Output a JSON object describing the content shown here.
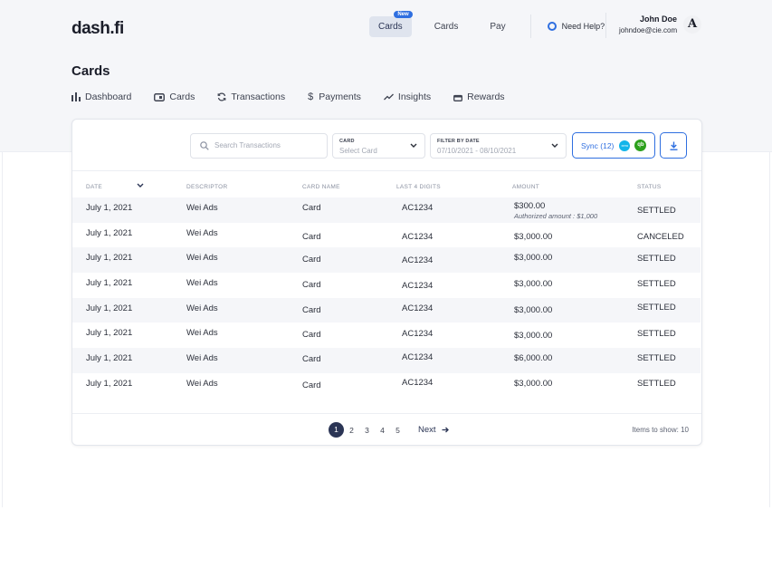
{
  "brand": {
    "logo": "dash.fi"
  },
  "topnav": {
    "items": [
      {
        "label": "Cards",
        "badge": "New",
        "active": true
      },
      {
        "label": "Cards"
      },
      {
        "label": "Pay"
      }
    ],
    "help_label": "Need Help?"
  },
  "user": {
    "name": "John Doe",
    "email": "johndoe@cie.com",
    "avatar_letter": "A"
  },
  "page": {
    "title": "Cards"
  },
  "subnav": [
    {
      "label": "Dashboard",
      "icon": "bar-chart-icon"
    },
    {
      "label": "Cards",
      "icon": "card-icon"
    },
    {
      "label": "Transactions",
      "icon": "refresh-icon"
    },
    {
      "label": "Payments",
      "icon": "dollar-icon"
    },
    {
      "label": "Insights",
      "icon": "trend-icon"
    },
    {
      "label": "Rewards",
      "icon": "gift-icon"
    }
  ],
  "filters": {
    "search_placeholder": "Search Transactions",
    "card_label": "CARD",
    "card_value": "Select Card",
    "date_label": "FILTER BY DATE",
    "date_value": "07/10/2021 - 08/10/2021",
    "sync_label": "Sync (12)",
    "xero_label": "xero",
    "qb_label": "qb"
  },
  "table": {
    "headers": [
      "DATE",
      "DESCRIPTOR",
      "CARD NAME",
      "LAST 4 DIGITS",
      "AMOUNT",
      "STATUS"
    ],
    "rows": [
      {
        "date": "July 1, 2021",
        "descriptor": "Wei Ads",
        "card": "Card",
        "digits": "AC1234",
        "amount": "$300.00",
        "note": "Authorized amount : $1,000",
        "status": "SETTLED"
      },
      {
        "date": "July 1, 2021",
        "descriptor": "Wei Ads",
        "card": "Card",
        "digits": "AC1234",
        "amount": "$3,000.00",
        "status": "CANCELED"
      },
      {
        "date": "July 1, 2021",
        "descriptor": "Wei Ads",
        "card": "Card",
        "digits": "AC1234",
        "amount": "$3,000.00",
        "status": "SETTLED"
      },
      {
        "date": "July 1, 2021",
        "descriptor": "Wei Ads",
        "card": "Card",
        "digits": "AC1234",
        "amount": "$3,000.00",
        "status": "SETTLED"
      },
      {
        "date": "July 1, 2021",
        "descriptor": "Wei Ads",
        "card": "Card",
        "digits": "AC1234",
        "amount": "$3,000.00",
        "status": "SETTLED"
      },
      {
        "date": "July 1, 2021",
        "descriptor": "Wei Ads",
        "card": "Card",
        "digits": "AC1234",
        "amount": "$3,000.00",
        "status": "SETTLED"
      },
      {
        "date": "July 1, 2021",
        "descriptor": "Wei Ads",
        "card": "Card",
        "digits": "AC1234",
        "amount": "$6,000.00",
        "status": "SETTLED"
      },
      {
        "date": "July 1, 2021",
        "descriptor": "Wei Ads",
        "card": "Card",
        "digits": "AC1234",
        "amount": "$3,000.00",
        "status": "SETTLED"
      }
    ]
  },
  "pagination": {
    "pages": [
      "1",
      "2",
      "3",
      "4",
      "5"
    ],
    "current": "1",
    "next_label": "Next",
    "items_label": "Items to show: 10"
  },
  "colors": {
    "accent": "#2f6fe0",
    "navy": "#2b3555",
    "shade": "#f5f6f9"
  }
}
